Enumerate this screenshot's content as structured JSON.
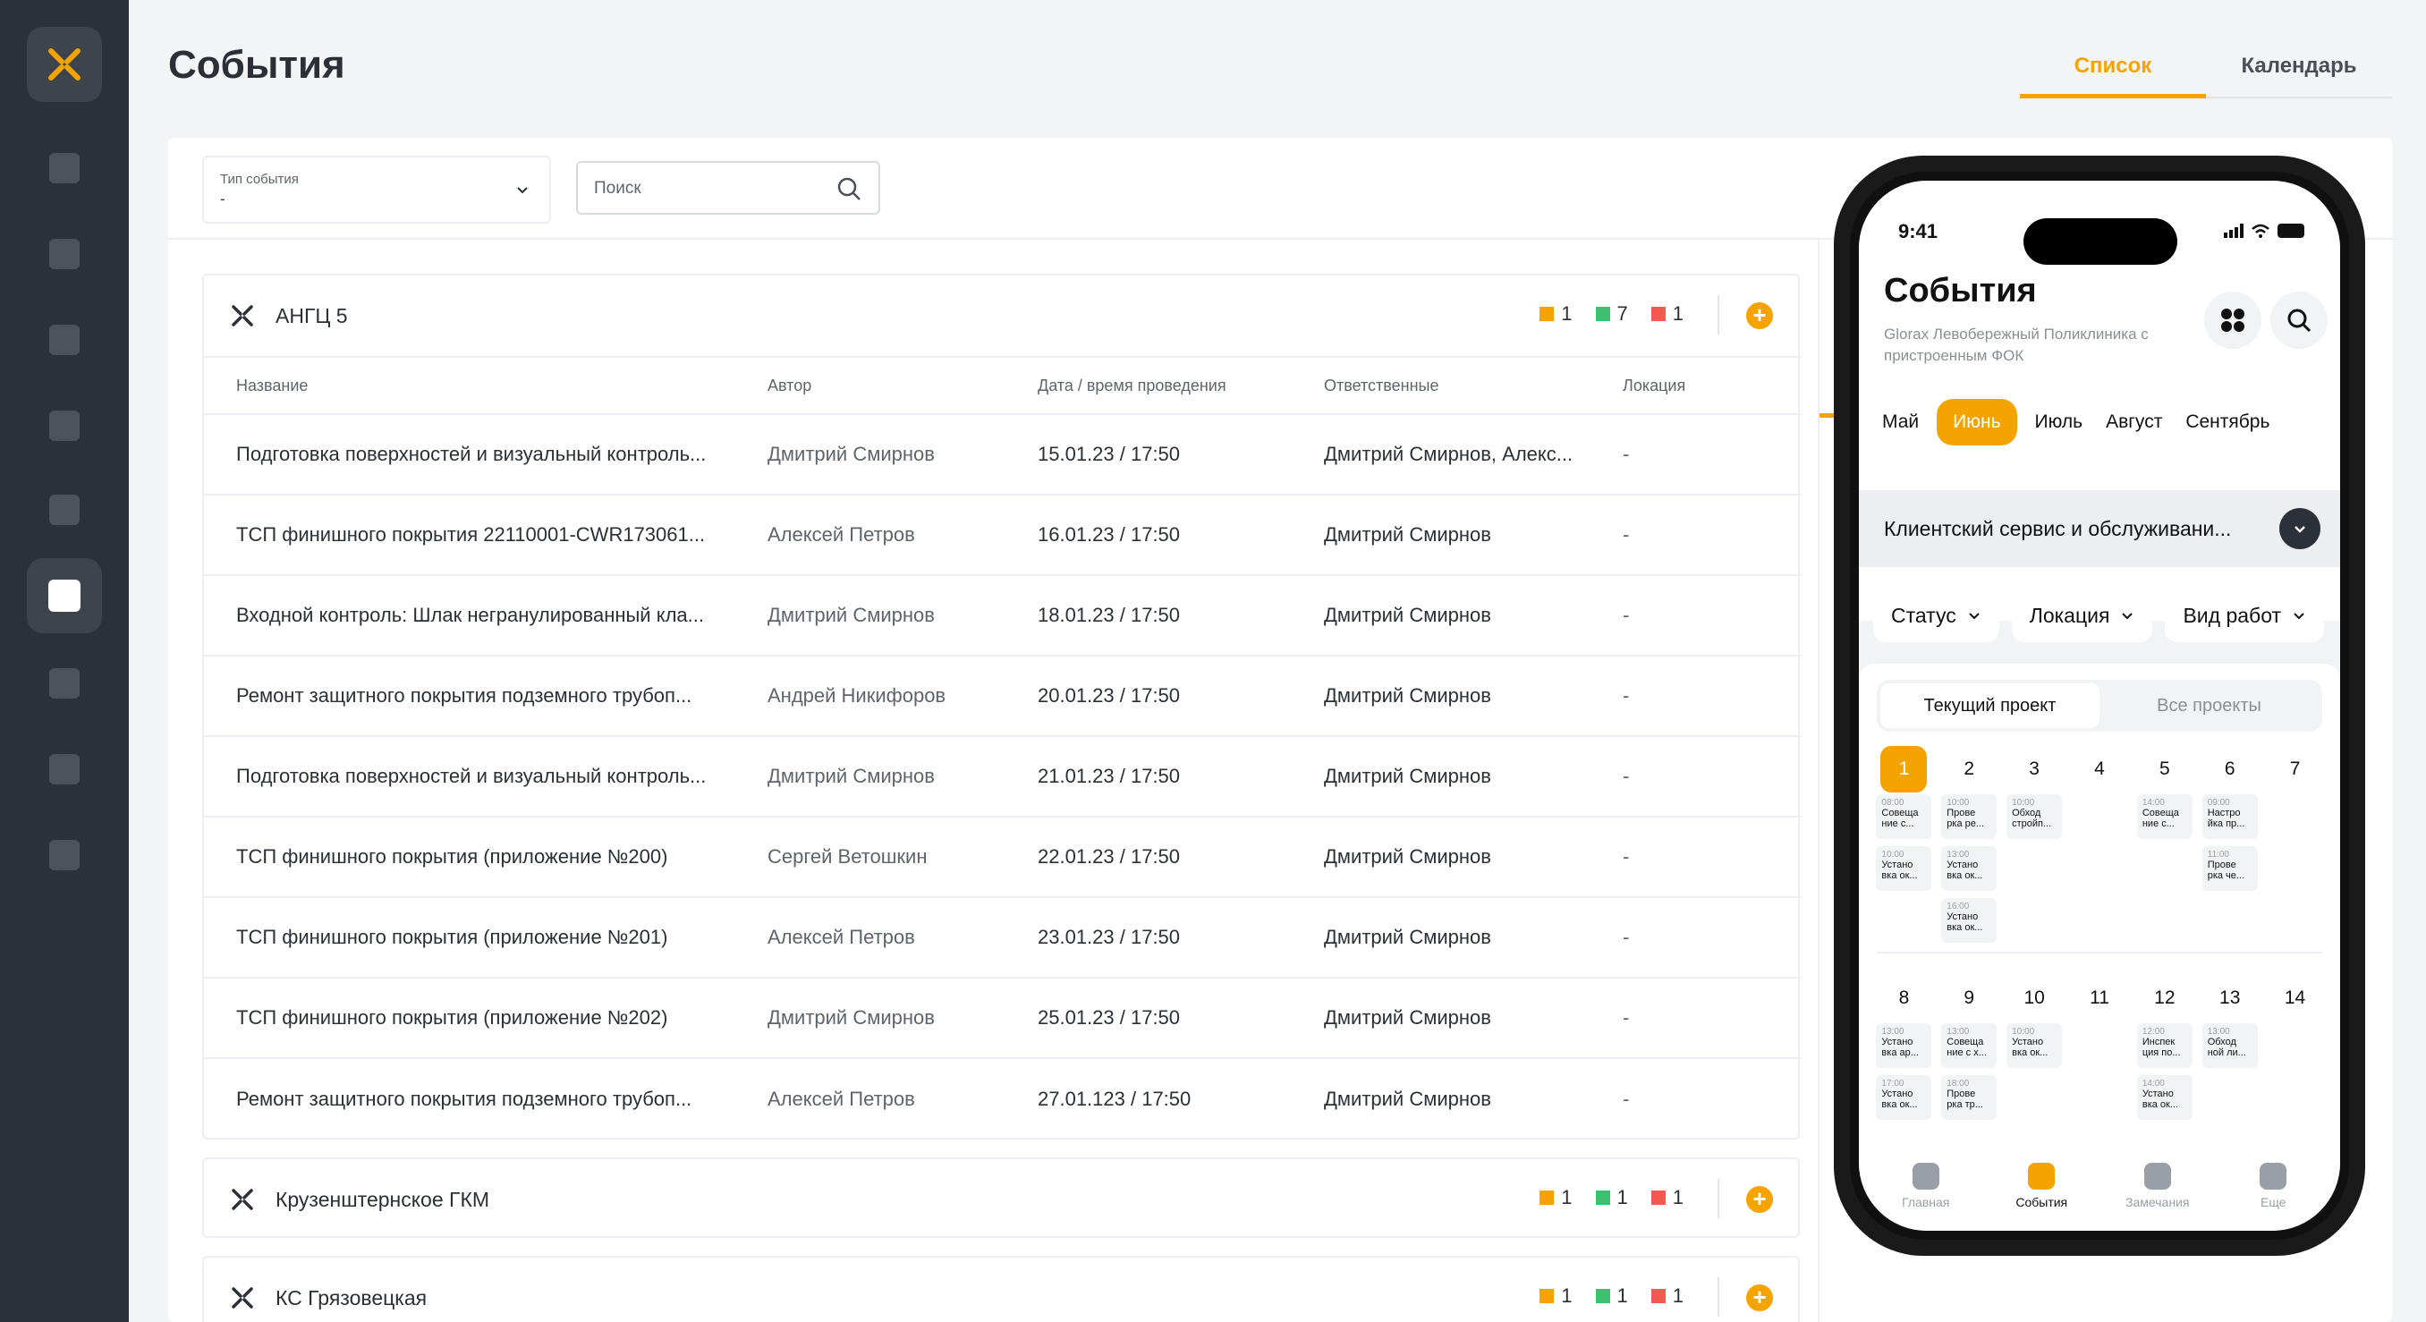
{
  "page": {
    "title": "События",
    "view_tabs": [
      {
        "label": "Список",
        "active": true
      },
      {
        "label": "Календарь",
        "active": false
      }
    ]
  },
  "sidebar": {
    "items": [
      {
        "icon": "video-icon"
      },
      {
        "icon": "clock-icon"
      },
      {
        "icon": "document-icon"
      },
      {
        "icon": "alert-icon"
      },
      {
        "icon": "check-icon"
      },
      {
        "icon": "calendar-icon",
        "active": true
      },
      {
        "icon": "building-icon"
      },
      {
        "icon": "chart-icon"
      },
      {
        "icon": "more-icon"
      }
    ]
  },
  "filters": {
    "type_label": "Тип события",
    "type_value": "-",
    "search_placeholder": "Поиск"
  },
  "colors": {
    "accent": "#f4a300",
    "orange": "#f4a300",
    "green": "#3cbf6e",
    "red": "#f05a4f",
    "sidebar": "#2c3138"
  },
  "table": {
    "columns": [
      "Название",
      "Автор",
      "Дата / время проведения",
      "Ответственные",
      "Локация"
    ]
  },
  "groups": [
    {
      "name": "АНГЦ 5",
      "counts": {
        "orange": "1",
        "green": "7",
        "red": "1"
      },
      "rows": [
        [
          "Подготовка поверхностей и визуальный контроль...",
          "Дмитрий Смирнов",
          "15.01.23 / 17:50",
          "Дмитрий Смирнов, Алекс...",
          "-"
        ],
        [
          "ТСП финишного покрытия 22110001-CWR173061...",
          "Алексей Петров",
          "16.01.23 / 17:50",
          "Дмитрий Смирнов",
          "-"
        ],
        [
          "Входной контроль: Шлак негранулированный кла...",
          "Дмитрий Смирнов",
          "18.01.23 / 17:50",
          "Дмитрий Смирнов",
          "-"
        ],
        [
          "Ремонт защитного покрытия подземного трубоп...",
          "Андрей Никифоров",
          "20.01.23 / 17:50",
          "Дмитрий Смирнов",
          "-"
        ],
        [
          "Подготовка поверхностей и визуальный контроль...",
          "Дмитрий Смирнов",
          "21.01.23 / 17:50",
          "Дмитрий Смирнов",
          "-"
        ],
        [
          "ТСП финишного покрытия (приложение №200)",
          "Сергей Ветошкин",
          "22.01.23 / 17:50",
          "Дмитрий Смирнов",
          "-"
        ],
        [
          "ТСП финишного покрытия (приложение №201)",
          "Алексей Петров",
          "23.01.23 / 17:50",
          "Дмитрий Смирнов",
          "-"
        ],
        [
          "ТСП финишного покрытия (приложение №202)",
          "Дмитрий Смирнов",
          "25.01.23 / 17:50",
          "Дмитрий Смирнов",
          "-"
        ],
        [
          "Ремонт защитного покрытия подземного трубоп...",
          "Алексей Петров",
          "27.01.123 / 17:50",
          "Дмитрий Смирнов",
          "-"
        ]
      ]
    },
    {
      "name": "Крузенштернское ГКМ",
      "counts": {
        "orange": "1",
        "green": "1",
        "red": "1"
      }
    },
    {
      "name": "КС Грязовецкая",
      "counts": {
        "orange": "1",
        "green": "1",
        "red": "1"
      }
    }
  ],
  "phone": {
    "time": "9:41",
    "title": "События",
    "subtitle": "Glorax Левобережный Поликлиника с пристроенным ФОК",
    "months": [
      {
        "label": "Май"
      },
      {
        "label": "Июнь",
        "active": true
      },
      {
        "label": "Июль"
      },
      {
        "label": "Август"
      },
      {
        "label": "Сентябрь"
      }
    ],
    "project": "Клиентский сервис и обслуживани...",
    "chips": [
      "Статус",
      "Локация",
      "Вид работ"
    ],
    "segments": [
      {
        "label": "Текущий проект",
        "active": true
      },
      {
        "label": "Все проекты"
      }
    ],
    "weeks": [
      {
        "days": [
          "1",
          "2",
          "3",
          "4",
          "5",
          "6",
          "7"
        ],
        "active_day": "1",
        "events": [
          [
            {
              "t": "08:00",
              "n": "Совеща ние с..."
            },
            {
              "t": "10:00",
              "n": "Устано вка ок..."
            }
          ],
          [
            {
              "t": "10:00",
              "n": "Прове рка ре..."
            },
            {
              "t": "13:00",
              "n": "Устано вка ок..."
            },
            {
              "t": "16:00",
              "n": "Устано вка ок..."
            }
          ],
          [
            {
              "t": "10:00",
              "n": "Обход стройп..."
            }
          ],
          [],
          [
            {
              "t": "14:00",
              "n": "Совеща ние с..."
            }
          ],
          [
            {
              "t": "09:00",
              "n": "Настро йка пр..."
            },
            {
              "t": "11:00",
              "n": "Прове рка че..."
            }
          ],
          []
        ]
      },
      {
        "days": [
          "8",
          "9",
          "10",
          "11",
          "12",
          "13",
          "14"
        ],
        "events": [
          [
            {
              "t": "13:00",
              "n": "Устано вка ар..."
            },
            {
              "t": "17:00",
              "n": "Устано вка ок..."
            }
          ],
          [
            {
              "t": "13:00",
              "n": "Совеща ние с х..."
            },
            {
              "t": "18:00",
              "n": "Прове рка тр..."
            }
          ],
          [
            {
              "t": "10:00",
              "n": "Устано вка ок..."
            }
          ],
          [],
          [
            {
              "t": "12:00",
              "n": "Инспек ция по..."
            },
            {
              "t": "14:00",
              "n": "Устано вка ок..."
            }
          ],
          [
            {
              "t": "13:00",
              "n": "Обход ной ли..."
            }
          ],
          []
        ]
      }
    ],
    "tabbar": [
      {
        "label": "Главная",
        "icon": "home-icon"
      },
      {
        "label": "События",
        "icon": "events-icon",
        "active": true
      },
      {
        "label": "Замечания",
        "icon": "remarks-icon"
      },
      {
        "label": "Еще",
        "icon": "more-icon"
      }
    ]
  }
}
